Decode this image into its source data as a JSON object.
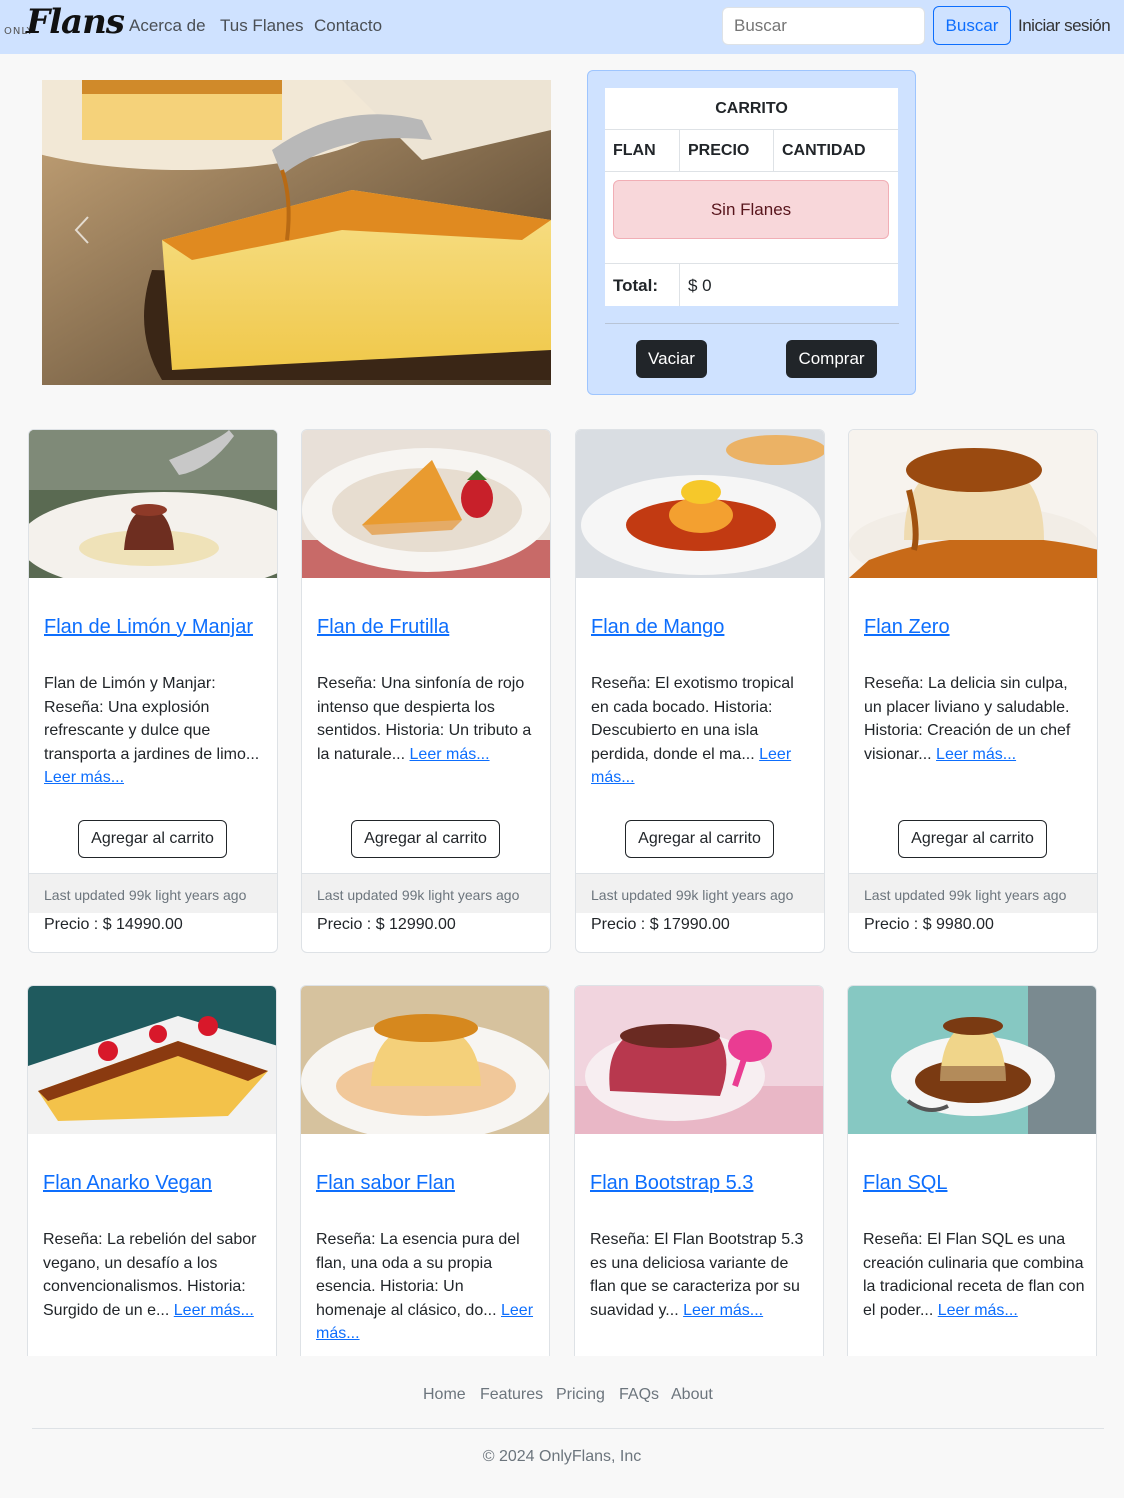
{
  "nav": {
    "logo_small": "ONLY",
    "logo_big": "Flans",
    "links": [
      "Acerca de",
      "Tus Flanes",
      "Contacto"
    ],
    "search_placeholder": "Buscar",
    "search_button": "Buscar",
    "login": "Iniciar sesión"
  },
  "cart": {
    "title": "CARRITO",
    "columns": [
      "FLAN",
      "PRECIO",
      "CANTIDAD"
    ],
    "empty_message": "Sin Flanes",
    "total_label": "Total:",
    "total_value": "$ 0",
    "clear_button": "Vaciar",
    "buy_button": "Comprar"
  },
  "cards": [
    {
      "title": "Flan de Limón y Manjar",
      "text": "Flan de Limón y Manjar: Reseña: Una explosión refrescante y dulce que transporta a jardines de limo...",
      "more": "Leer más...",
      "button": "Agregar al carrito",
      "updated": "Last updated 99k light years ago",
      "price": "Precio : $ 14990.00"
    },
    {
      "title": "Flan de Frutilla",
      "text": "Reseña: Una sinfonía de rojo intenso que despierta los sentidos. Historia: Un tributo a la naturale...",
      "more": "Leer más...",
      "button": "Agregar al carrito",
      "updated": "Last updated 99k light years ago",
      "price": "Precio : $ 12990.00"
    },
    {
      "title": "Flan de Mango",
      "text": "Reseña: El exotismo tropical en cada bocado. Historia: Descubierto en una isla perdida, donde el ma...",
      "more": "Leer más...",
      "button": "Agregar al carrito",
      "updated": "Last updated 99k light years ago",
      "price": "Precio : $ 17990.00"
    },
    {
      "title": "Flan Zero",
      "text": "Reseña: La delicia sin culpa, un placer liviano y saludable. Historia: Creación de un chef visionar...",
      "more": "Leer más...",
      "button": "Agregar al carrito",
      "updated": "Last updated 99k light years ago",
      "price": "Precio : $ 9980.00"
    },
    {
      "title": "Flan Anarko Vegan",
      "text": "Reseña: La rebelión del sabor vegano, un desafío a los convencionalismos. Historia: Surgido de un e...",
      "more": "Leer más..."
    },
    {
      "title": "Flan sabor Flan",
      "text": "Reseña: La esencia pura del flan, una oda a su propia esencia. Historia: Un homenaje al clásico, do...",
      "more": "Leer más..."
    },
    {
      "title": "Flan Bootstrap 5.3",
      "text": "Reseña: El Flan Bootstrap 5.3 es una deliciosa variante de flan que se caracteriza por su suavidad y...",
      "more": "Leer más..."
    },
    {
      "title": "Flan SQL",
      "text": "Reseña: El Flan SQL es una creación culinaria que combina la tradicional receta de flan con el poder...",
      "more": "Leer más..."
    }
  ],
  "footer": {
    "links": [
      "Home",
      "Features",
      "Pricing",
      "FAQs",
      "About"
    ],
    "copyright": "© 2024 OnlyFlans, Inc"
  }
}
